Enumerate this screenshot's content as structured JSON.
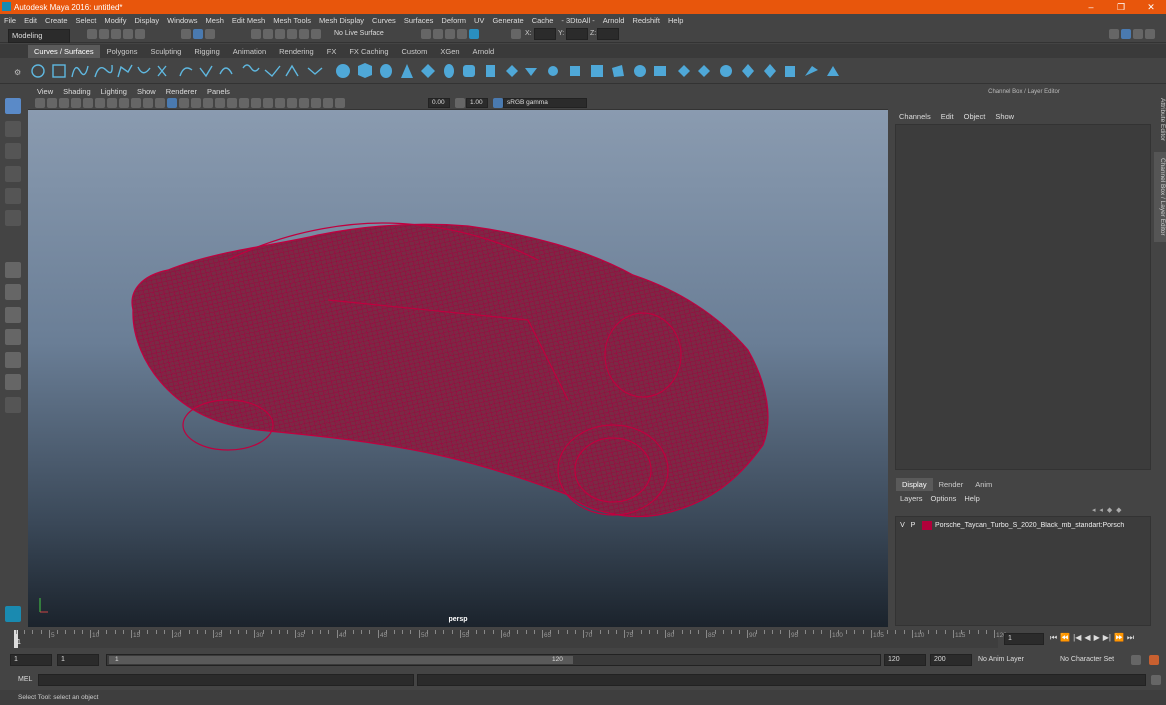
{
  "app": {
    "title": "Autodesk Maya 2016: untitled*",
    "window_controls": [
      "–",
      "❐",
      "✕"
    ]
  },
  "menubar": [
    "File",
    "Edit",
    "Create",
    "Select",
    "Modify",
    "Display",
    "Windows",
    "Mesh",
    "Edit Mesh",
    "Mesh Tools",
    "Mesh Display",
    "Curves",
    "Surfaces",
    "Deform",
    "UV",
    "Generate",
    "Cache",
    "- 3DtoAll -",
    "Arnold",
    "Redshift",
    "Help"
  ],
  "statusline": {
    "mode": "Modeling",
    "live_surface": "No Live Surface",
    "x_label": "X:",
    "y_label": "Y:",
    "z_label": "Z:"
  },
  "shelf_tabs": [
    "Curves / Surfaces",
    "Polygons",
    "Sculpting",
    "Rigging",
    "Animation",
    "Rendering",
    "FX",
    "FX Caching",
    "Custom",
    "XGen",
    "Arnold"
  ],
  "shelf_active": "Curves / Surfaces",
  "viewport": {
    "menu": [
      "View",
      "Shading",
      "Lighting",
      "Show",
      "Renderer",
      "Panels"
    ],
    "gamma_value1": "0.00",
    "gamma_value2": "1.00",
    "color_space": "sRGB gamma",
    "camera": "persp",
    "wireframe_color": "#b0003a"
  },
  "channel_box": {
    "title": "Channel Box / Layer Editor",
    "menu": [
      "Channels",
      "Edit",
      "Object",
      "Show"
    ]
  },
  "side_tabs": [
    "Attribute Editor",
    "Channel Box / Layer Editor"
  ],
  "layer_editor": {
    "tabs": [
      "Display",
      "Render",
      "Anim"
    ],
    "active_tab": "Display",
    "menu": [
      "Layers",
      "Options",
      "Help"
    ],
    "layer": {
      "v": "V",
      "p": "P",
      "color": "#b0003a",
      "name": "Porsche_Taycan_Turbo_S_2020_Black_mb_standart:Porsch"
    }
  },
  "timeline": {
    "labels": [
      "5",
      "10",
      "15",
      "20",
      "25",
      "30",
      "35",
      "40",
      "45",
      "50",
      "55",
      "60",
      "65",
      "70",
      "75",
      "80",
      "85",
      "90",
      "95",
      "100",
      "105",
      "110",
      "115",
      "120"
    ],
    "current_frame": "1",
    "current_field": "1",
    "playback_icons": [
      "⏮",
      "⏪",
      "|◀",
      "◀",
      "▶",
      "▶|",
      "⏩",
      "⏭"
    ]
  },
  "range": {
    "start": "1",
    "anim_start": "1",
    "slider_start": "1",
    "slider_end": "120",
    "end": "120",
    "anim_end": "200",
    "anim_layer": "No Anim Layer",
    "char_set": "No Character Set"
  },
  "command_line": {
    "label": "MEL"
  },
  "help_line": "Select Tool: select an object"
}
